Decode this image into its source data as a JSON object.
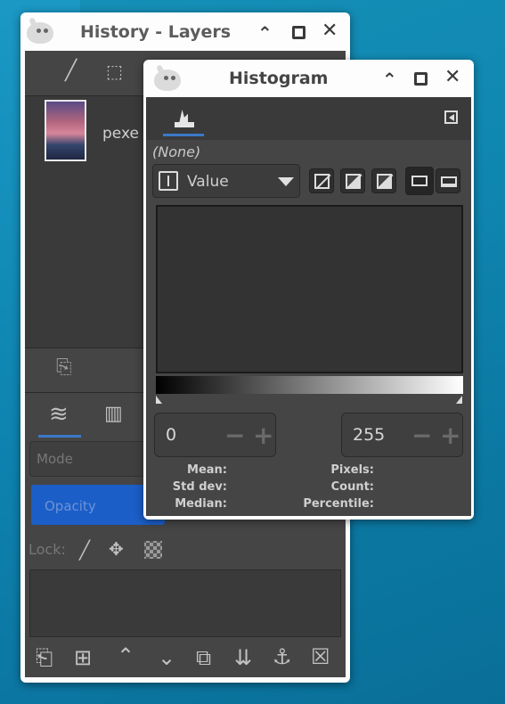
{
  "layers_window": {
    "title": "History - Layers",
    "layer_name_partial": "pexe",
    "mode_label": "Mode",
    "opacity_label": "Opacity",
    "lock_label": "Lock:"
  },
  "histogram_window": {
    "title": "Histogram",
    "image_name": "(None)",
    "channel": "Value",
    "range_low": "0",
    "range_high": "255",
    "stats_left": {
      "mean": "Mean:",
      "std_dev": "Std dev:",
      "median": "Median:"
    },
    "stats_right": {
      "pixels": "Pixels:",
      "count": "Count:",
      "percentile": "Percentile:"
    }
  },
  "colors": {
    "accent_blue": "#3b79c8",
    "opacity_bar": "#1b5ec8",
    "panel_dark": "#454545",
    "desktop": "#0f86b0"
  },
  "icons": {
    "titlebar": [
      "gimp-logo-icon",
      "chevron-up-icon",
      "maximize-icon",
      "close-icon"
    ],
    "dock_tabs": [
      "paintbrush-icon",
      "selection-icon",
      "histogram-icon",
      "layers-icon",
      "channels-icon"
    ],
    "layer_actions": [
      "new-layer-icon",
      "new-group-icon",
      "raise-layer-icon",
      "lower-layer-icon",
      "duplicate-layer-icon",
      "merge-layer-icon",
      "anchor-layer-icon",
      "delete-layer-icon"
    ]
  }
}
